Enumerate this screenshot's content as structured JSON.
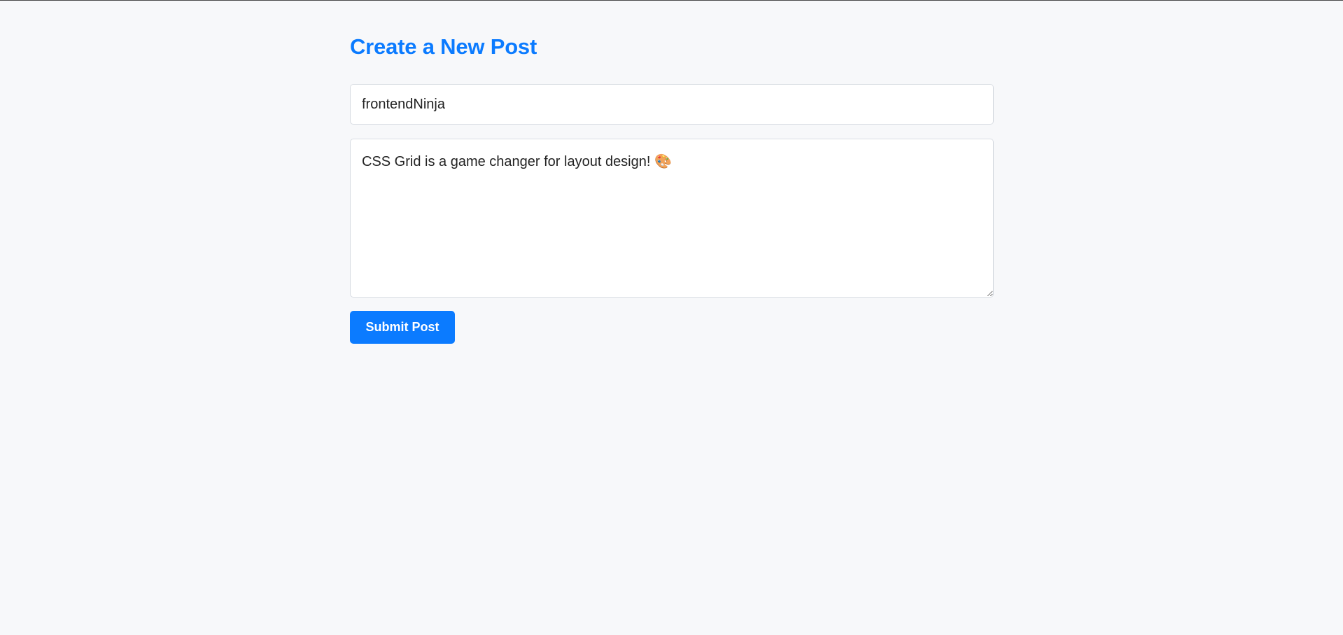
{
  "page": {
    "title": "Create a New Post"
  },
  "form": {
    "username": {
      "value": "frontendNinja"
    },
    "content": {
      "value": "CSS Grid is a game changer for layout design! 🎨"
    },
    "submit_label": "Submit Post"
  },
  "colors": {
    "accent": "#0b7bff",
    "background": "#f7f8fa",
    "field_border": "#d9dde3"
  }
}
